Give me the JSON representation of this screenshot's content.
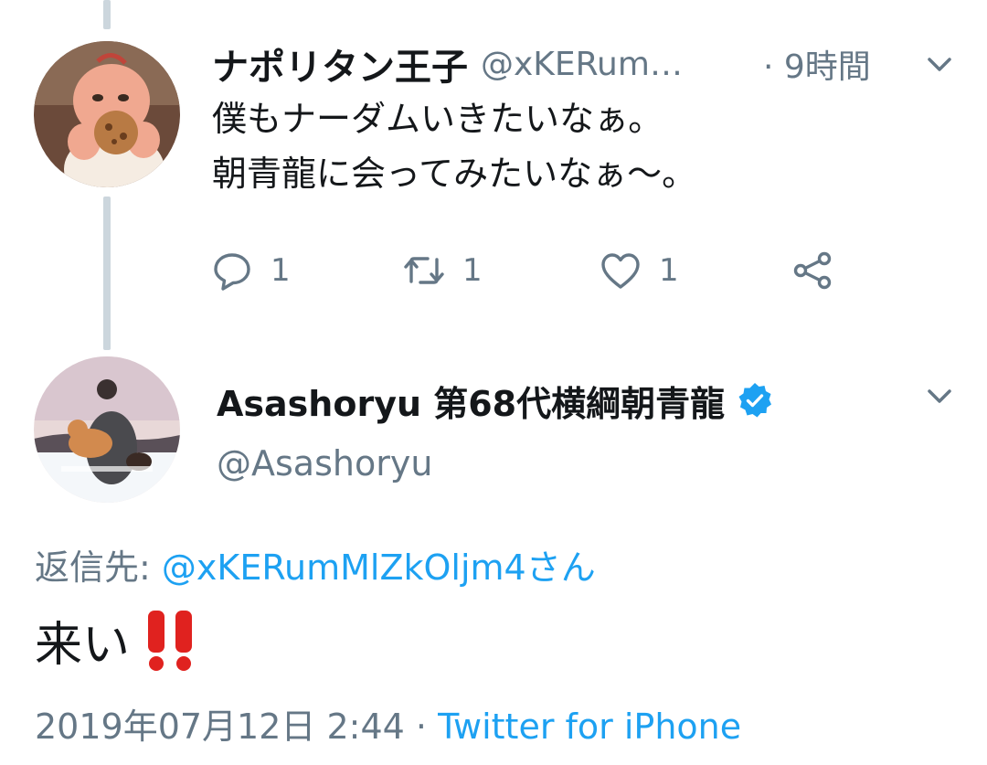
{
  "tweet1": {
    "display_name": "ナポリタン王子",
    "handle": "@xKERum…",
    "time": "· 9時間",
    "body_line1": "僕もナーダムいきたいなぁ。",
    "body_line2": "朝青龍に会ってみたいなぁ〜。",
    "reply_count": "1",
    "retweet_count": "1",
    "like_count": "1"
  },
  "tweet2": {
    "display_name": "Asashoryu 第68代横綱朝青龍",
    "handle": "@Asashoryu",
    "reply_to_label": "返信先:",
    "reply_to_mention": "@xKERumMlZkOljm4さん",
    "body": "来い",
    "date": "2019年07月12日 2:44 ·",
    "source": "Twitter for iPhone"
  },
  "colors": {
    "accent": "#1da1f2",
    "text": "#14171a",
    "muted": "#657786",
    "thread_line": "#ccd6dd",
    "emoji_red": "#e0221f"
  },
  "icons": {
    "reply": "reply-bubble-icon",
    "retweet": "retweet-icon",
    "like": "heart-icon",
    "share": "share-icon",
    "menu": "chevron-down-icon",
    "verified": "verified-badge-icon",
    "emoji": "double-exclamation-emoji"
  }
}
